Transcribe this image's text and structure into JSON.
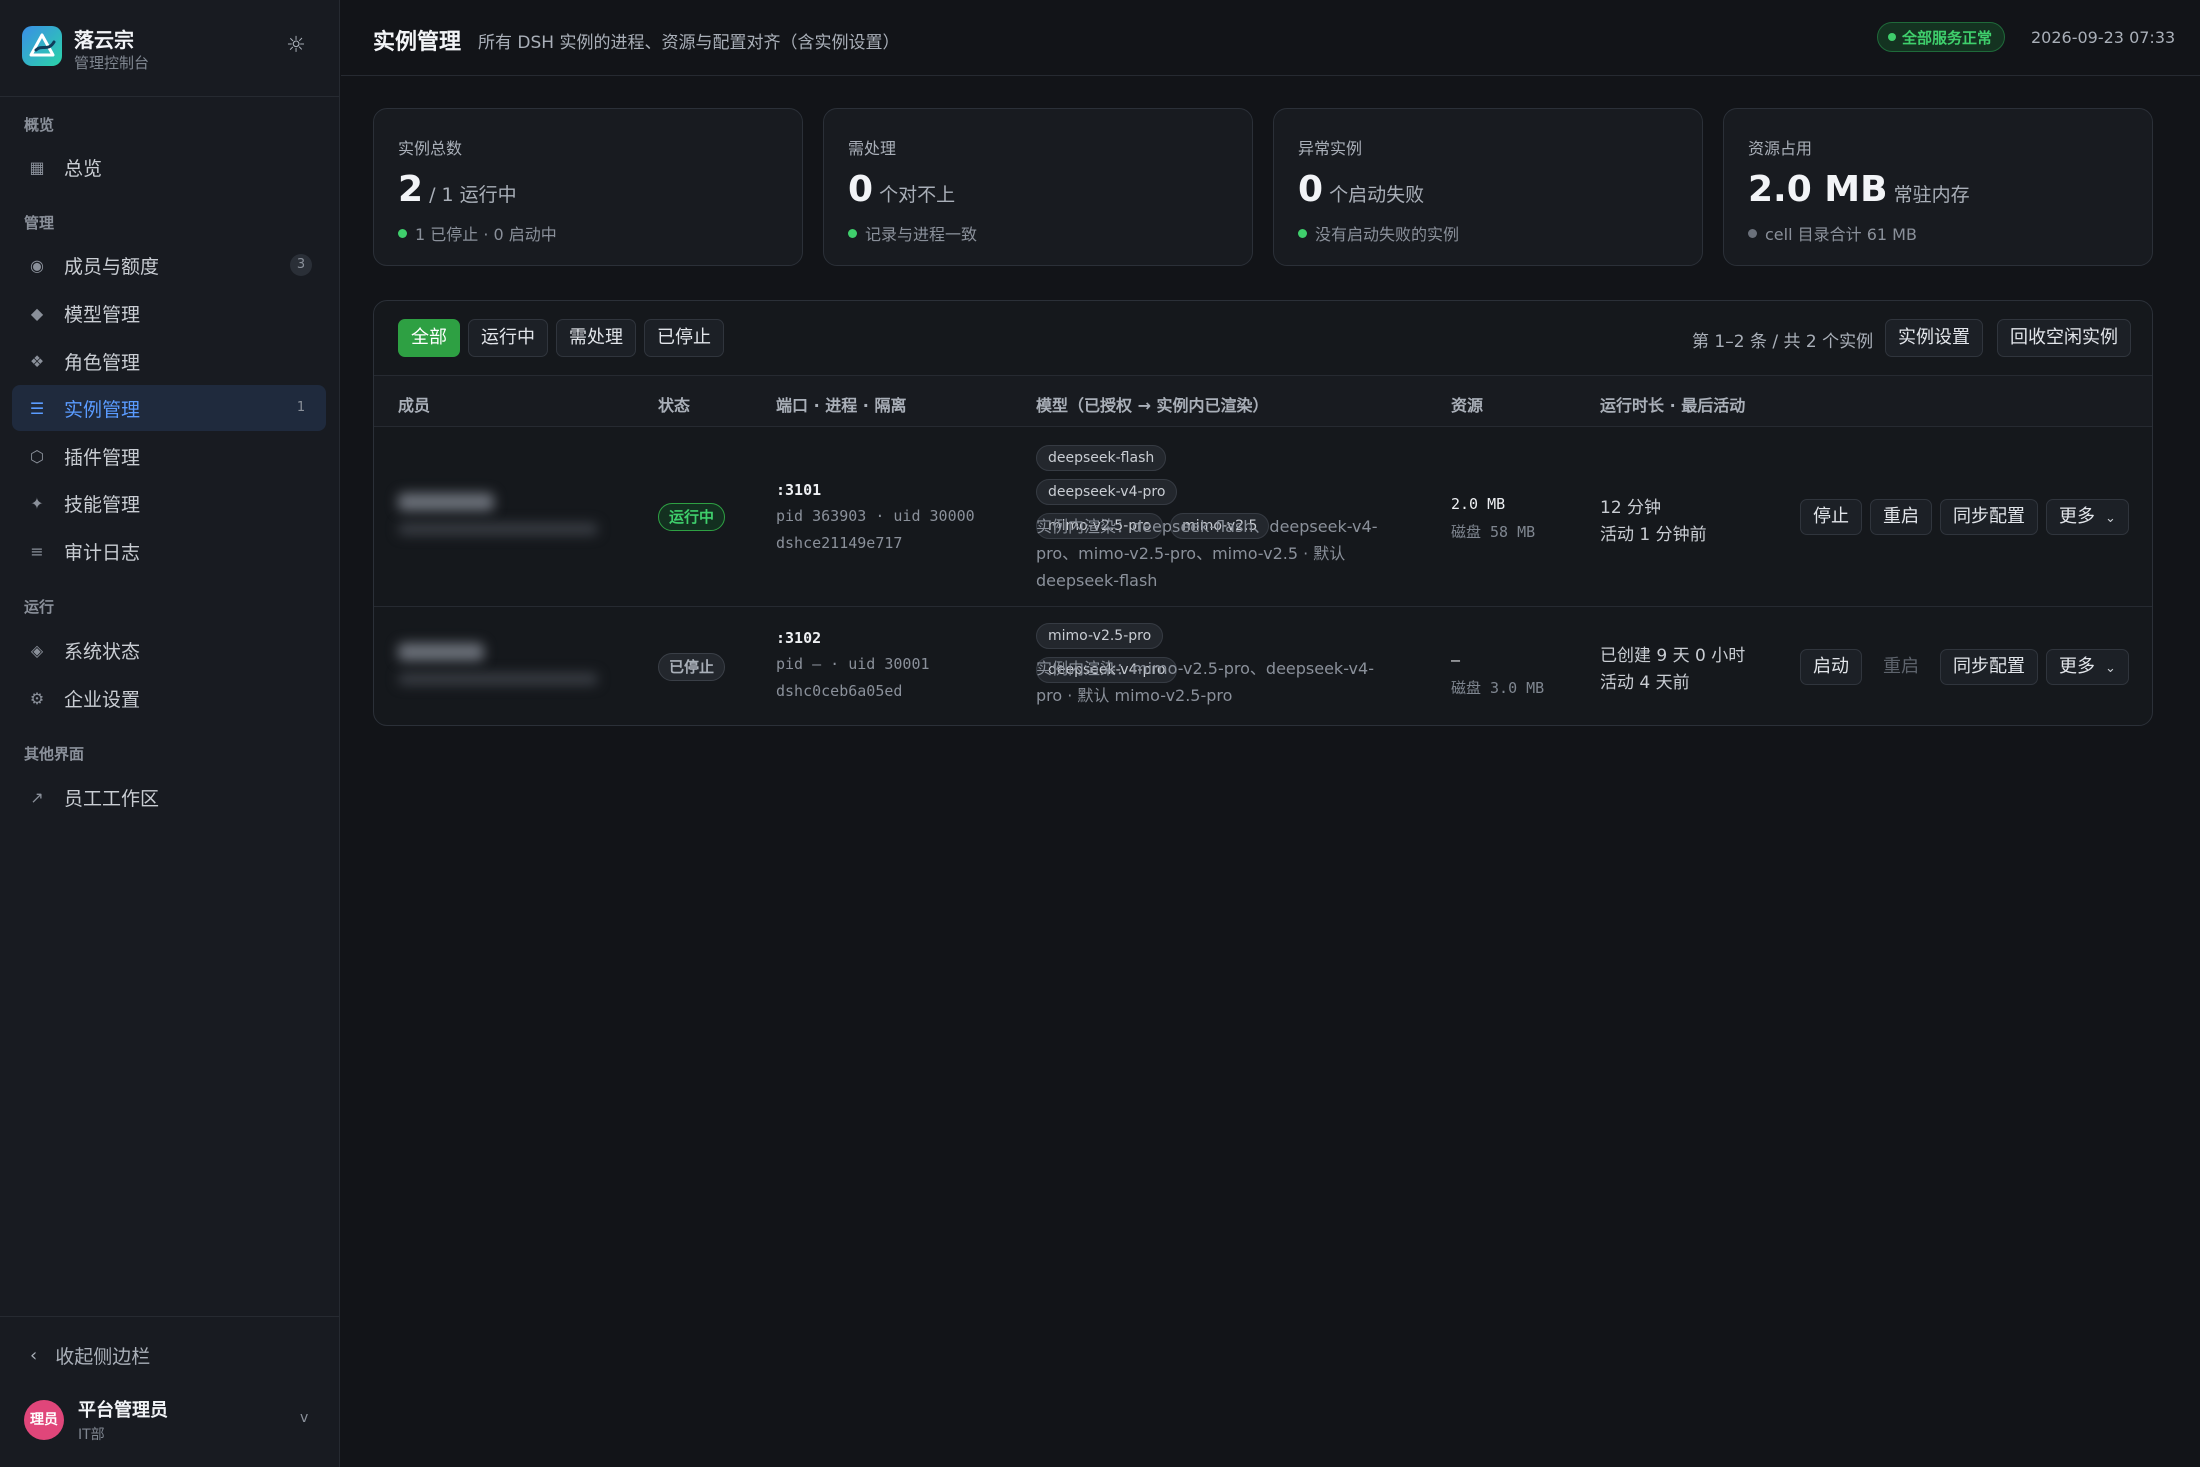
{
  "brand": {
    "name": "落云宗",
    "subtitle": "管理控制台",
    "settings_icon": "sun-gear-icon"
  },
  "sidebar": {
    "sections": [
      {
        "title": "概览",
        "items": [
          {
            "label": "总览",
            "icon": "grid-icon"
          }
        ]
      },
      {
        "title": "管理",
        "items": [
          {
            "label": "成员与额度",
            "icon": "circle-dot-icon",
            "badge": "3"
          },
          {
            "label": "模型管理",
            "icon": "diamond-small-icon"
          },
          {
            "label": "角色管理",
            "icon": "four-diamonds-icon"
          },
          {
            "label": "实例管理",
            "icon": "list-icon",
            "badge": "1",
            "active": true
          },
          {
            "label": "插件管理",
            "icon": "hexagon-icon"
          },
          {
            "label": "技能管理",
            "icon": "sparkle-icon"
          },
          {
            "label": "审计日志",
            "icon": "lines-icon"
          }
        ]
      },
      {
        "title": "运行",
        "items": [
          {
            "label": "系统状态",
            "icon": "diamond-dot-icon"
          },
          {
            "label": "企业设置",
            "icon": "gear-icon"
          }
        ]
      },
      {
        "title": "其他界面",
        "items": [
          {
            "label": "员工工作区",
            "icon": "arrow-out-icon"
          }
        ]
      }
    ],
    "collapse_label": "收起侧边栏",
    "user": {
      "avatar_text": "理员",
      "name": "平台管理员",
      "dept": "IT部"
    }
  },
  "header": {
    "title": "实例管理",
    "description": "所有 DSH 实例的进程、资源与配置对齐（含实例设置）",
    "status": "全部服务正常",
    "time": "2026-09-23 07:33"
  },
  "cards": [
    {
      "label": "实例总数",
      "value": "2",
      "unit": "/ 1 运行中",
      "note": "1 已停止 · 0 启动中",
      "dot": "green"
    },
    {
      "label": "需处理",
      "value": "0",
      "unit": "个对不上",
      "note": "记录与进程一致",
      "dot": "green"
    },
    {
      "label": "异常实例",
      "value": "0",
      "unit": "个启动失败",
      "note": "没有启动失败的实例",
      "dot": "green"
    },
    {
      "label": "资源占用",
      "value": "2.0 MB",
      "unit": "常驻内存",
      "note": "cell 目录合计 61 MB",
      "dot": "grey"
    }
  ],
  "table": {
    "filters": [
      "全部",
      "运行中",
      "需处理",
      "已停止"
    ],
    "active_filter": "全部",
    "page_info": "第 1–2 条 / 共 2 个实例",
    "settings_button": "实例设置",
    "reclaim_button": "回收空闲实例",
    "columns": [
      "成员",
      "状态",
      "端口 · 进程 · 隔离",
      "模型（已授权 → 实例内已渲染）",
      "资源",
      "运行时长 · 最后活动"
    ],
    "rows": [
      {
        "status": "运行中",
        "status_kind": "running",
        "port": ":3101",
        "proc_line1": "pid 363903 · uid 30000",
        "proc_line2": "dshce21149e717",
        "tags": [
          "deepseek-flash",
          "deepseek-v4-pro",
          "mimo-v2.5-pro",
          "mimo-v2.5"
        ],
        "rendered": "实例内渲染：deepseek-flash、deepseek-v4-pro、mimo-v2.5-pro、mimo-v2.5 · 默认 deepseek-flash",
        "res_main": "2.0 MB",
        "res_sub": "磁盘 58 MB",
        "dur_line1": "12 分钟",
        "dur_line2": "活动 1 分钟前",
        "actions": [
          {
            "label": "停止"
          },
          {
            "label": "重启"
          },
          {
            "label": "同步配置"
          },
          {
            "label": "更多",
            "chevron": true
          }
        ]
      },
      {
        "status": "已停止",
        "status_kind": "stopped",
        "port": ":3102",
        "proc_line1": "pid — · uid 30001",
        "proc_line2": "dshc0ceb6a05ed",
        "tags": [
          "mimo-v2.5-pro",
          "deepseek-v4-pro"
        ],
        "rendered": "实例内渲染：mimo-v2.5-pro、deepseek-v4-pro · 默认 mimo-v2.5-pro",
        "res_main": "—",
        "res_sub": "磁盘 3.0 MB",
        "dur_line1": "已创建 9 天 0 小时",
        "dur_line2": "活动 4 天前",
        "actions": [
          {
            "label": "启动"
          },
          {
            "label": "重启",
            "disabled": true
          },
          {
            "label": "同步配置"
          },
          {
            "label": "更多",
            "chevron": true
          }
        ]
      }
    ]
  },
  "colors": {
    "accent": "#2ea043",
    "active_blue": "#5a9bff",
    "background": "#121418",
    "sidebar": "#181b21",
    "avatar": "#e0467a"
  }
}
